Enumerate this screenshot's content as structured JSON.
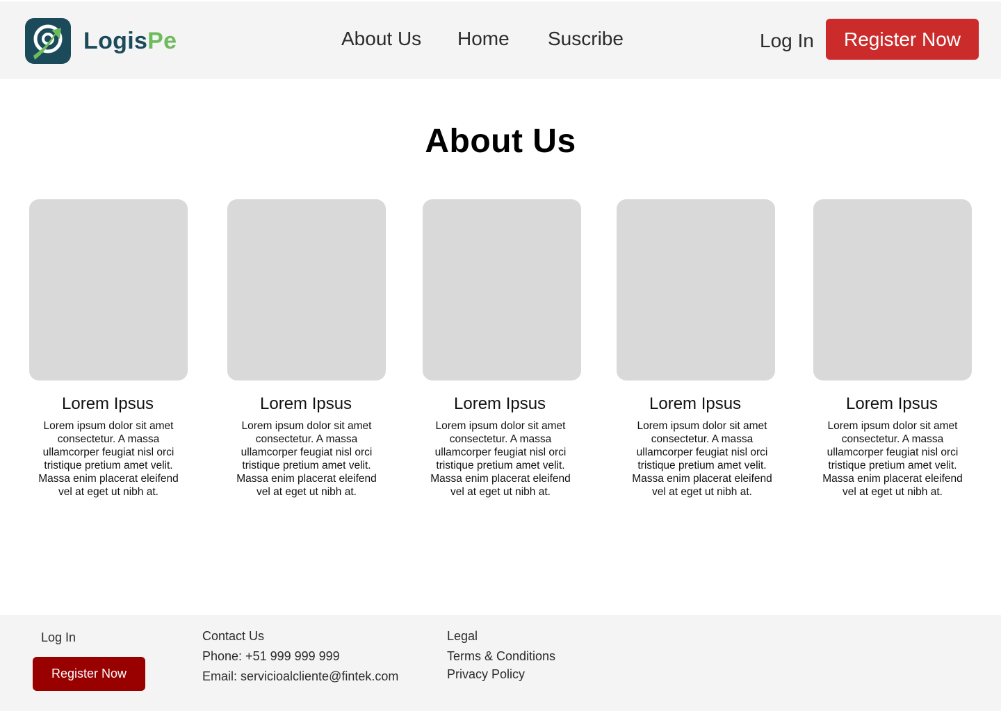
{
  "header": {
    "logo": {
      "part1": "Logis",
      "part2": "Pe"
    },
    "nav": [
      {
        "label": "About Us"
      },
      {
        "label": "Home"
      },
      {
        "label": "Suscribe"
      }
    ],
    "login_label": "Log In",
    "register_label": "Register Now"
  },
  "page": {
    "title": "About Us"
  },
  "cards": [
    {
      "title": "Lorem Ipsus",
      "text": "Lorem ipsum dolor sit amet consectetur. A massa ullamcorper feugiat nisl orci tristique pretium amet velit. Massa enim placerat eleifend vel at eget ut nibh at."
    },
    {
      "title": "Lorem Ipsus",
      "text": "Lorem ipsum dolor sit amet consectetur. A massa ullamcorper feugiat nisl orci tristique pretium amet velit. Massa enim placerat eleifend vel at eget ut nibh at."
    },
    {
      "title": "Lorem Ipsus",
      "text": "Lorem ipsum dolor sit amet consectetur. A massa ullamcorper feugiat nisl orci tristique pretium amet velit. Massa enim placerat eleifend vel at eget ut nibh at."
    },
    {
      "title": "Lorem Ipsus",
      "text": "Lorem ipsum dolor sit amet consectetur. A massa ullamcorper feugiat nisl orci tristique pretium amet velit. Massa enim placerat eleifend vel at eget ut nibh at."
    },
    {
      "title": "Lorem Ipsus",
      "text": "Lorem ipsum dolor sit amet consectetur. A massa ullamcorper feugiat nisl orci tristique pretium amet velit. Massa enim placerat eleifend vel at eget ut nibh at."
    }
  ],
  "footer": {
    "login_label": "Log In",
    "register_label": "Register Now",
    "contact": {
      "heading": "Contact Us",
      "phone": "Phone: +51 999 999 999",
      "email": "Email: servicioalcliente@fintek.com"
    },
    "legal": {
      "heading": "Legal",
      "terms": "Terms & Conditions",
      "privacy": "Privacy Policy"
    }
  },
  "colors": {
    "brand_dark": "#1b4a5a",
    "brand_green": "#6dbb5d",
    "register_red": "#cc2b2b",
    "footer_register": "#990000",
    "header_bg": "#f4f4f4",
    "placeholder": "#d9d9d9"
  },
  "icons": {
    "logo": "logo-mark-icon"
  }
}
